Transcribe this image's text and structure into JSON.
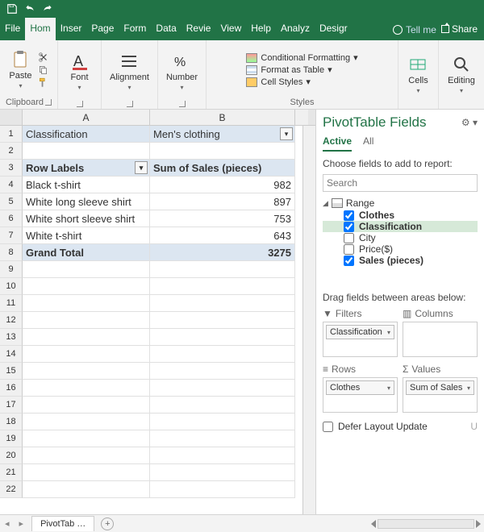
{
  "ribbon": {
    "tabs": [
      "File",
      "Hom",
      "Inser",
      "Page",
      "Form",
      "Data",
      "Revie",
      "View",
      "Help",
      "Analyz",
      "Desigr"
    ],
    "active_tab_index": 1,
    "tell_me": "Tell me",
    "share": "Share",
    "groups": {
      "clipboard": {
        "label": "Clipboard",
        "paste": "Paste"
      },
      "font": {
        "label": "Font"
      },
      "alignment": {
        "label": "Alignment"
      },
      "number": {
        "label": "Number"
      },
      "styles": {
        "label": "Styles",
        "conditional": "Conditional Formatting",
        "table": "Format as Table",
        "cellstyles": "Cell Styles"
      },
      "cells": {
        "label": "Cells"
      },
      "editing": {
        "label": "Editing"
      }
    }
  },
  "sheet": {
    "columns": [
      "A",
      "B"
    ],
    "rows": [
      1,
      2,
      3,
      4,
      5,
      6,
      7,
      8,
      9,
      10,
      11,
      12,
      13,
      14,
      15,
      16,
      17,
      18,
      19,
      20,
      21,
      22
    ],
    "data": {
      "A1": "Classification",
      "B1": "Men's clothing",
      "A3": "Row Labels",
      "B3": "Sum of Sales (pieces)",
      "A4": "Black t-shirt",
      "B4": "982",
      "A5": "White long sleeve shirt",
      "B5": "897",
      "A6": "White short sleeve shirt",
      "B6": "753",
      "A7": "White t-shirt",
      "B7": "643",
      "A8": "Grand Total",
      "B8": "3275"
    },
    "active_tab": "PivotTab …"
  },
  "pane": {
    "title": "PivotTable Fields",
    "tabs": {
      "active": "Active",
      "all": "All"
    },
    "prompt": "Choose fields to add to report:",
    "search_placeholder": "Search",
    "range_label": "Range",
    "fields": [
      {
        "name": "Clothes",
        "checked": true
      },
      {
        "name": "Classification",
        "checked": true
      },
      {
        "name": "City",
        "checked": false
      },
      {
        "name": "Price($)",
        "checked": false
      },
      {
        "name": "Sales (pieces)",
        "checked": true
      }
    ],
    "drag_hint": "Drag fields between areas below:",
    "areas": {
      "filters": {
        "label": "Filters",
        "chip": "Classification"
      },
      "columns": {
        "label": "Columns"
      },
      "rows": {
        "label": "Rows",
        "chip": "Clothes"
      },
      "values": {
        "label": "Values",
        "chip": "Sum of Sales"
      }
    },
    "defer": "Defer Layout Update",
    "update_btn": "U"
  }
}
